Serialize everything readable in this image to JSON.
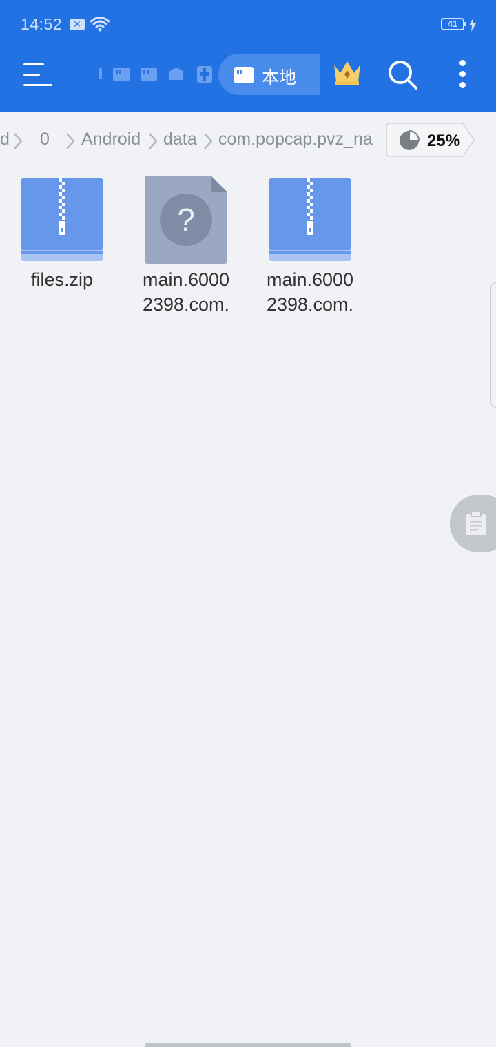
{
  "status_bar": {
    "time": "14:52",
    "battery_level": "41",
    "icons": [
      "notification-x-icon",
      "wifi-icon",
      "battery-icon",
      "charging-bolt-icon"
    ]
  },
  "toolbar": {
    "icons": [
      "menu-icon",
      "sd-card-icon",
      "android-icon",
      "sliders-icon",
      "vip-crown-icon",
      "search-icon",
      "more-vertical-icon"
    ],
    "local_label": "本地"
  },
  "breadcrumb": {
    "items": [
      "d",
      "0",
      "Android",
      "data",
      "com.popcap.pvz_na"
    ]
  },
  "storage": {
    "usage_percent": "25%",
    "usage_fraction": 0.25
  },
  "files": [
    {
      "name_line1": "files.zip",
      "name_line2": "",
      "type": "zip"
    },
    {
      "name_line1": "main.6000",
      "name_line2": "2398.com.",
      "type": "unknown"
    },
    {
      "name_line1": "main.6000",
      "name_line2": "2398.com.",
      "type": "zip"
    }
  ],
  "colors": {
    "toolbar_blue": "#2372e3",
    "chip_blue": "#4a8cec",
    "zip_blue": "#6797ea",
    "unknown_gray": "#9aa8c2",
    "background": "#f0f2f5"
  }
}
